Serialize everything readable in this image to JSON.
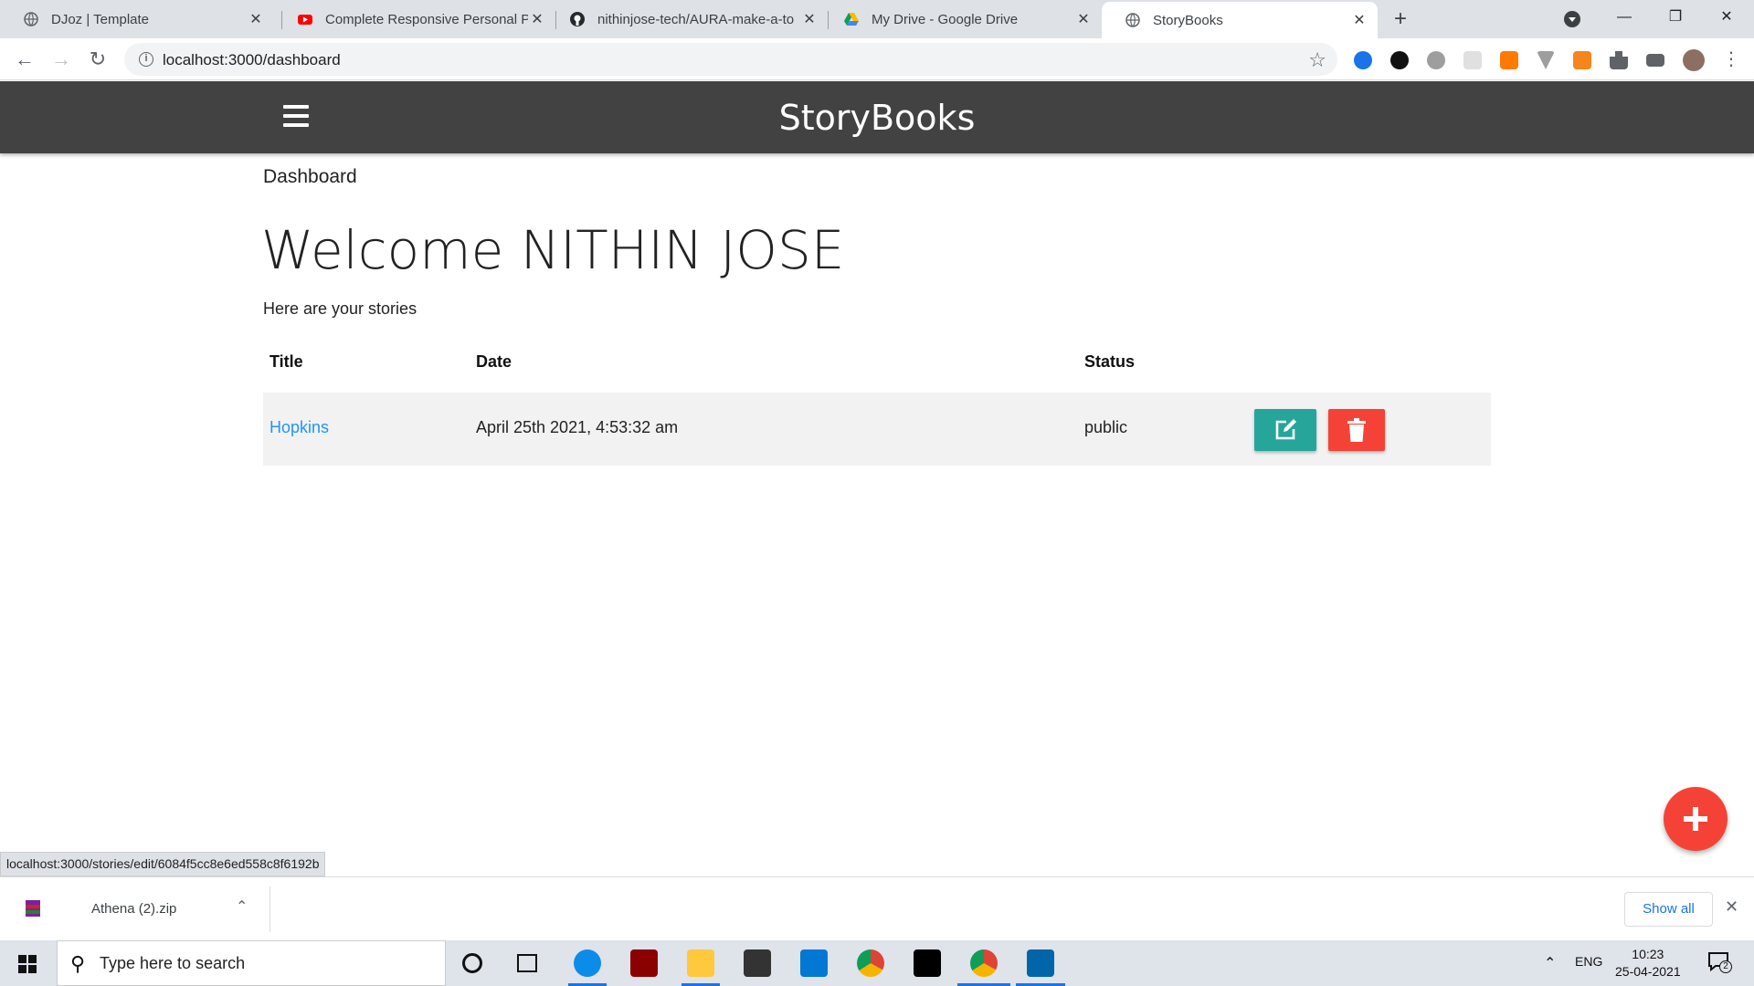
{
  "browser": {
    "tabs": [
      {
        "title": "DJoz | Template",
        "icon": "globe-icon"
      },
      {
        "title": "Complete Responsive Personal Po",
        "icon": "youtube-icon"
      },
      {
        "title": "nithinjose-tech/AURA-make-a-to",
        "icon": "github-icon"
      },
      {
        "title": "My Drive - Google Drive",
        "icon": "google-drive-icon"
      },
      {
        "title": "StoryBooks",
        "icon": "globe-icon",
        "active": true
      }
    ],
    "new_tab": "+",
    "url": "localhost:3000/dashboard",
    "close_glyph": "✕"
  },
  "app": {
    "brand": "StoryBooks",
    "breadcrumb": "Dashboard",
    "welcome": "Welcome NITHIN JOSE",
    "subtitle": "Here are your stories",
    "table": {
      "headers": [
        "Title",
        "Date",
        "Status"
      ],
      "rows": [
        {
          "title": "Hopkins",
          "date": "April 25th 2021, 4:53:32 am",
          "status": "public"
        }
      ]
    },
    "colors": {
      "appbar": "#424242",
      "edit": "#26a69a",
      "delete": "#f44336",
      "link": "#2196f3",
      "fab": "#f44336"
    }
  },
  "status_bar": {
    "hover_url": "localhost:3000/stories/edit/6084f5cc8e6ed558c8f6192b"
  },
  "downloads": {
    "file": "Athena (2).zip",
    "show_all": "Show all"
  },
  "taskbar": {
    "search_placeholder": "Type here to search",
    "language": "ENG",
    "time": "10:23",
    "date": "25-04-2021",
    "notification_count": "2"
  }
}
